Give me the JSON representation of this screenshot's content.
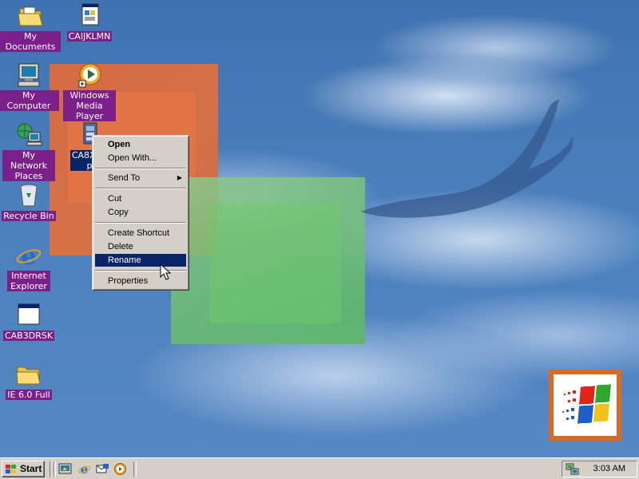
{
  "desktop": {
    "icons": [
      {
        "label": "My Documents",
        "icon": "folder-documents-icon"
      },
      {
        "label": "CAIJKLMN",
        "icon": "setup-program-icon"
      },
      {
        "label": "My Computer",
        "icon": "my-computer-icon"
      },
      {
        "label": "Windows Media Player",
        "icon": "media-player-icon"
      },
      {
        "label": "My Network Places",
        "icon": "network-places-icon"
      },
      {
        "label": "CA8XER",
        "label_tail": "p",
        "icon": "cab-file-icon"
      },
      {
        "label": "Recycle Bin",
        "icon": "recycle-bin-icon"
      },
      {
        "label": "Internet Explorer",
        "icon": "internet-explorer-icon"
      },
      {
        "label": "CAB3DRSK",
        "icon": "window-app-icon"
      },
      {
        "label": "IE 6.0 Full",
        "icon": "folder-icon"
      }
    ]
  },
  "context_menu": {
    "items": [
      {
        "label": "Open",
        "bold": true
      },
      {
        "label": "Open With..."
      },
      {
        "label": "Send To",
        "submenu": true
      },
      {
        "label": "Cut"
      },
      {
        "label": "Copy"
      },
      {
        "label": "Create Shortcut"
      },
      {
        "label": "Delete"
      },
      {
        "label": "Rename",
        "highlighted": true
      },
      {
        "label": "Properties"
      }
    ]
  },
  "taskbar": {
    "start_label": "Start",
    "quick_launch": [
      "show-desktop-icon",
      "internet-explorer-icon",
      "outlook-express-icon",
      "media-player-icon"
    ],
    "clock": "3:03 AM",
    "tray_icon": "network-tray-icon"
  },
  "colors": {
    "desktop_blue": "#3f72b0",
    "icon_label_bg": "#7b1f8a",
    "selection": "#0a246a",
    "taskbar": "#d4d0c8"
  }
}
